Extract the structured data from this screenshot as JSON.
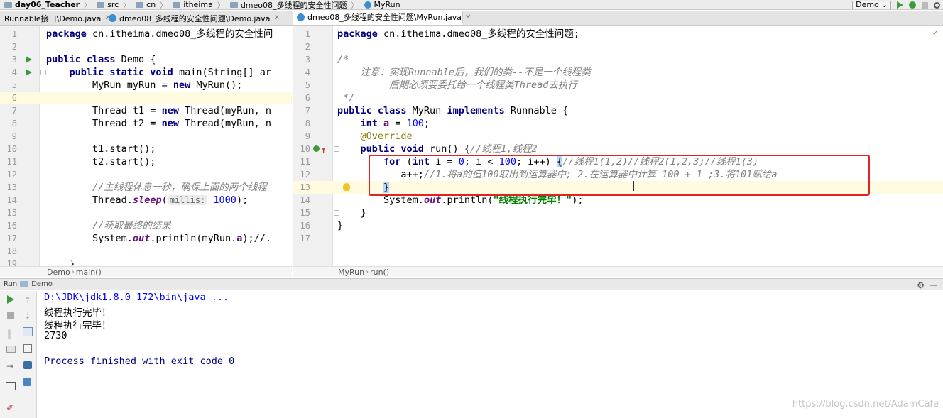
{
  "breadcrumbs": [
    "day06_Teacher",
    "src",
    "cn",
    "itheima",
    "dmeo08_多线程的安全性问题",
    "MyRun"
  ],
  "run_config": "Demo",
  "tabs": [
    {
      "label": "Runnable接口\\Demo.java",
      "active": false
    },
    {
      "label": "dmeo08_多线程的安全性问题\\Demo.java",
      "active": false
    },
    {
      "label": "dmeo08_多线程的安全性问题\\MyRun.java",
      "active": true
    }
  ],
  "left_editor": {
    "line_numbers": [
      "1",
      "2",
      "3",
      "4",
      "5",
      "6",
      "7",
      "8",
      "9",
      "10",
      "11",
      "12",
      "13",
      "14",
      "15",
      "16",
      "17",
      "18",
      "19"
    ],
    "lines": [
      {
        "pre": "",
        "kw": "package",
        "rest": " cn.itheima.dmeo08_多线程的安全性问"
      },
      {
        "pre": "",
        "rest": ""
      },
      {
        "kw": "public class",
        "rest": " Demo {"
      },
      {
        "pre": "    ",
        "kw": "public static void",
        "rest": " main(String[] ar"
      },
      {
        "pre": "        ",
        "rest": "MyRun myRun = ",
        "kw2": "new",
        "rest2": " MyRun();"
      },
      {
        "pre": "",
        "rest": ""
      },
      {
        "pre": "        ",
        "rest": "Thread t1 = ",
        "kw2": "new",
        "rest2": " Thread(myRun, n"
      },
      {
        "pre": "        ",
        "rest": "Thread t2 = ",
        "kw2": "new",
        "rest2": " Thread(myRun, n"
      },
      {
        "pre": "",
        "rest": ""
      },
      {
        "pre": "        ",
        "rest": "t1.start();"
      },
      {
        "pre": "        ",
        "rest": "t2.start();"
      },
      {
        "pre": "",
        "rest": ""
      },
      {
        "pre": "        ",
        "cm": "//主线程休息一秒，确保上面的两个线程"
      },
      {
        "pre": "        ",
        "rest": "Thread.",
        "stat": "sleep",
        "rest2": "(",
        "hint": "millis:",
        "num": " 1000",
        "rest3": ");"
      },
      {
        "pre": "",
        "rest": ""
      },
      {
        "pre": "        ",
        "cm": "//获取最终的结果"
      },
      {
        "pre": "        ",
        "rest": "System.",
        "stat": "out",
        "rest2": ".println(myRun.",
        "fld": "a",
        "rest3": ");//."
      },
      {
        "pre": "",
        "rest": ""
      },
      {
        "pre": "    ",
        "rest": "}"
      }
    ],
    "crumb": [
      "Demo",
      "main()"
    ]
  },
  "right_editor": {
    "line_numbers": [
      "1",
      "2",
      "3",
      "4",
      "5",
      "6",
      "7",
      "8",
      "9",
      "10",
      "11",
      "12",
      "13",
      "14",
      "15",
      "16",
      "17"
    ],
    "l1_kw": "package",
    "l1_rest": " cn.itheima.dmeo08_多线程的安全性问题;",
    "l3": "/*",
    "l4": "    注意：实现Runnable后，我们的类--不是一个线程类",
    "l5": "         后期必须要委托给一个线程类Thread去执行",
    "l6": " */",
    "l7_kw": "public class",
    "l7_rest": " MyRun ",
    "l7_kw2": "implements",
    "l7_rest2": " Runnable {",
    "l8_kw": "int",
    "l8_fld": "a",
    "l8_eq": " = ",
    "l8_num": "100",
    "l8_end": ";",
    "l9": "@Override",
    "l10_kw": "public void",
    "l10_rest": " run() {",
    "l10_cm": "//线程1,线程2",
    "l11_kw": "for",
    "l11_a": " (",
    "l11_kw2": "int",
    "l11_b": " i = ",
    "l11_n1": "0",
    "l11_c": "; i < ",
    "l11_n2": "100",
    "l11_d": "; i++) ",
    "l11_brace": "{",
    "l11_cm": "//线程1(1,2)//线程2(1,2,3)//线程1(3)",
    "l12_a": "a++;",
    "l12_cm": "//1.将a的值100取出到运算器中; 2.在运算器中计算 100 + 1 ;3.将101赋给a",
    "l13_brace": "}",
    "l14_a": "System.",
    "l14_stat": "out",
    "l14_b": ".println(",
    "l14_str": "\"线程执行完毕！\"",
    "l14_c": ");",
    "l15": "}",
    "l16": "}",
    "crumb": [
      "MyRun",
      "run()"
    ]
  },
  "run_window": {
    "title": "Run",
    "config": "Demo",
    "output": [
      {
        "text": "D:\\JDK\\jdk1.8.0_172\\bin\\java ...",
        "type": "cmd"
      },
      {
        "text": "线程执行完毕！",
        "type": "out"
      },
      {
        "text": "线程执行完毕！",
        "type": "out"
      },
      {
        "text": "2730",
        "type": "out"
      },
      {
        "text": "",
        "type": "out"
      },
      {
        "text": "Process finished with exit code 0",
        "type": "proc"
      }
    ]
  },
  "watermark": "https://blog.csdn.net/AdamCafe"
}
